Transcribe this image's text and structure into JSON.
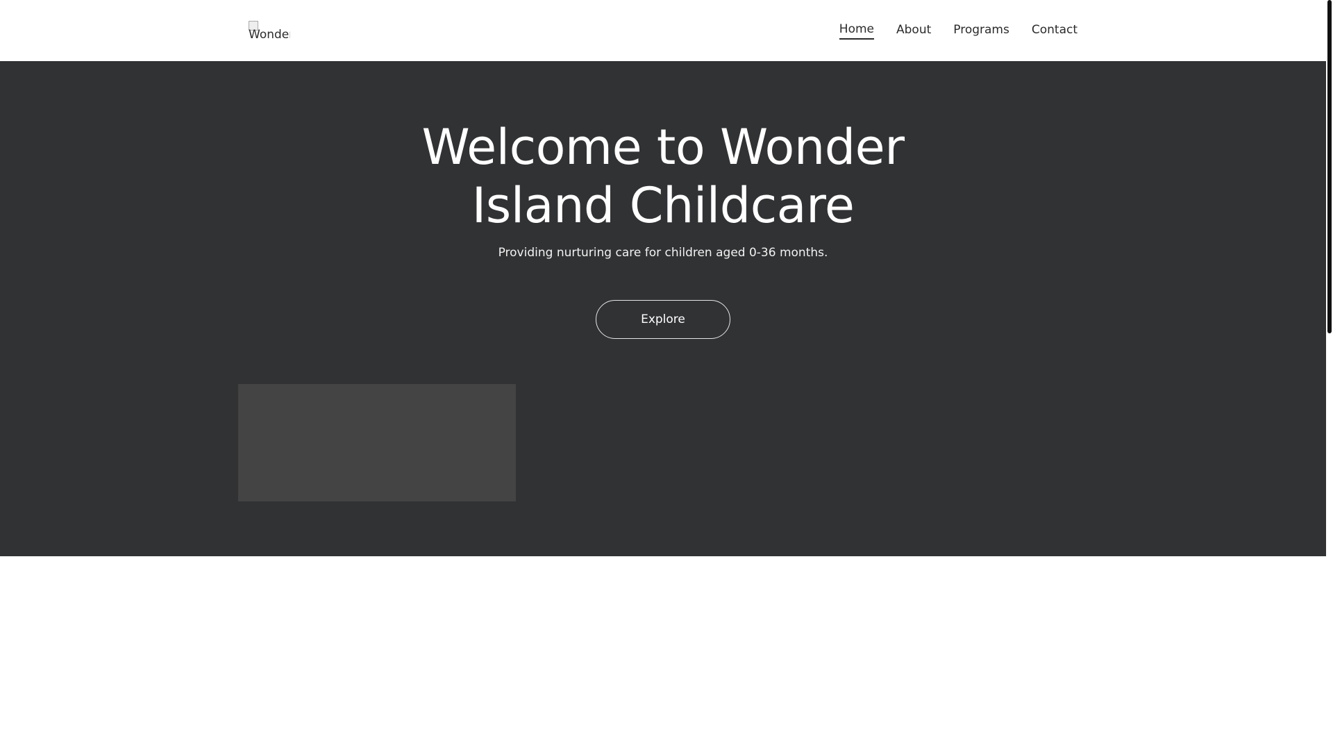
{
  "header": {
    "logo_alt_text": "Wonder",
    "nav": [
      {
        "label": "Home",
        "active": true
      },
      {
        "label": "About",
        "active": false
      },
      {
        "label": "Programs",
        "active": false
      },
      {
        "label": "Contact",
        "active": false
      }
    ]
  },
  "hero": {
    "title_line1": "Welcome to Wonder",
    "title_line2": "Island Childcare",
    "subtitle": "Providing nurturing care for children aged 0-36 months.",
    "button_label": "Explore"
  },
  "colors": {
    "hero_background": "#313234",
    "image_placeholder": "#444444",
    "header_background": "#ffffff",
    "text_dark": "#2b2b2b",
    "text_light": "#ffffff"
  }
}
